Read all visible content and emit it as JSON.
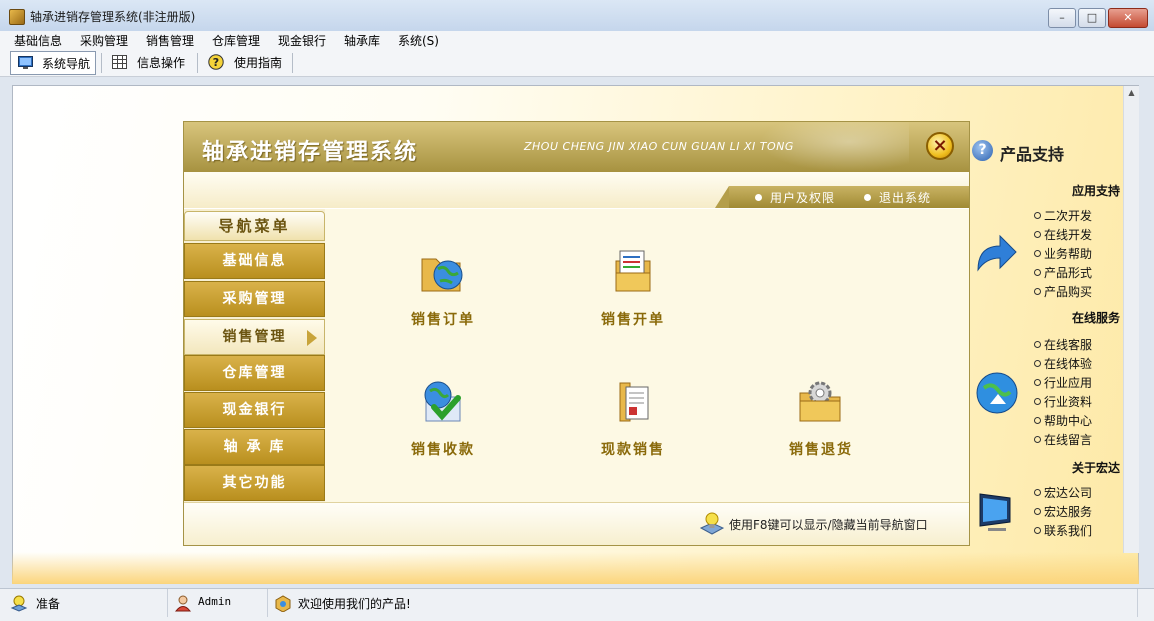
{
  "window": {
    "title": "轴承进销存管理系统(非注册版)"
  },
  "menubar": {
    "items": [
      "基础信息",
      "采购管理",
      "销售管理",
      "仓库管理",
      "现金银行",
      "轴承库",
      "系统(S)"
    ]
  },
  "toolbar": {
    "buttons": [
      {
        "label": "系统导航",
        "icon": "monitor-icon"
      },
      {
        "label": "信息操作",
        "icon": "grid-icon"
      },
      {
        "label": "使用指南",
        "icon": "help-icon"
      }
    ]
  },
  "panel": {
    "title": "轴承进销存管理系统",
    "pinyin": "ZHOU CHENG JIN XIAO CUN GUAN LI XI TONG",
    "close": "×",
    "sub_links": [
      "用户及权限",
      "退出系统"
    ],
    "nav_header": "导航菜单",
    "nav_items": [
      "基础信息",
      "采购管理",
      "销售管理",
      "仓库管理",
      "现金银行",
      "轴 承 库",
      "其它功能"
    ],
    "active_nav_index": 2,
    "functions": [
      {
        "label": "销售订单",
        "icon": "globe-folder-icon"
      },
      {
        "label": "销售开单",
        "icon": "document-folder-icon"
      },
      {
        "label": "销售收款",
        "icon": "globe-check-icon"
      },
      {
        "label": "现款销售",
        "icon": "file-folder-icon"
      },
      {
        "label": "销售退货",
        "icon": "gear-folder-icon"
      }
    ],
    "footer_tip": "使用F8键可以显示/隐藏当前导航窗口"
  },
  "support": {
    "title": "产品支持",
    "sections": [
      {
        "heading": "应用支持",
        "links": [
          "二次开发",
          "在线开发",
          "业务帮助",
          "产品形式",
          "产品购买"
        ]
      },
      {
        "heading": "在线服务",
        "links": [
          "在线客服",
          "在线体验",
          "行业应用",
          "行业资料",
          "帮助中心",
          "在线留言"
        ]
      },
      {
        "heading": "关于宏达",
        "links": [
          "宏达公司",
          "宏达服务",
          "联系我们"
        ]
      }
    ]
  },
  "statusbar": {
    "ready": "准备",
    "user": "Admin",
    "welcome": "欢迎使用我们的产品!"
  },
  "colors": {
    "accent_gold": "#b98f1e",
    "panel_header": "#a79240",
    "link_text": "#111111"
  }
}
